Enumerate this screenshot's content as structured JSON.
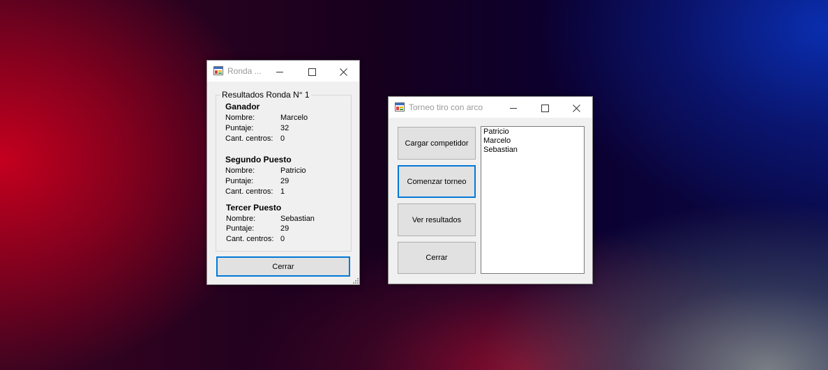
{
  "ronda_window": {
    "title": "Ronda ...",
    "group_title": "Resultados Ronda N° 1",
    "field_labels": {
      "nombre": "Nombre:",
      "puntaje": "Puntaje:",
      "centros": "Cant. centros:"
    },
    "places": [
      {
        "heading": "Ganador",
        "nombre": "Marcelo",
        "puntaje": "32",
        "centros": "0"
      },
      {
        "heading": "Segundo Puesto",
        "nombre": "Patricio",
        "puntaje": "29",
        "centros": "1"
      },
      {
        "heading": "Tercer Puesto",
        "nombre": "Sebastian",
        "puntaje": "29",
        "centros": "0"
      }
    ],
    "close_button": "Cerrar"
  },
  "torneo_window": {
    "title": "Torneo tiro con arco",
    "buttons": {
      "cargar": "Cargar competidor",
      "comenzar": "Comenzar torneo",
      "ver": "Ver resultados",
      "cerrar": "Cerrar"
    },
    "competitors": [
      "Patricio",
      "Marcelo",
      "Sebastian"
    ]
  },
  "colors": {
    "focus_border": "#0078d7",
    "window_bg": "#f0f0f0"
  }
}
